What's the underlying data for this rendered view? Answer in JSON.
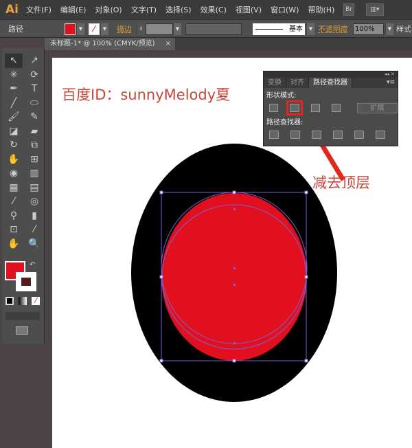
{
  "app": {
    "logo": "Ai"
  },
  "menu": [
    "文件(F)",
    "编辑(E)",
    "对象(O)",
    "文字(T)",
    "选择(S)",
    "效果(C)",
    "视图(V)",
    "窗口(W)",
    "帮助(H)"
  ],
  "menu_buttons": {
    "bridge": "Br",
    "workspace": "▥▾"
  },
  "control": {
    "type": "路径",
    "fill_color": "#e2101e",
    "stroke_label": "描边",
    "stroke_style": "基本",
    "opacity_label": "不透明度",
    "opacity": "100%",
    "style_label": "样式"
  },
  "document_tab": {
    "title": "未标题-1* @ 100% (CMYK/预览)",
    "close": "×"
  },
  "tools": [
    "↖",
    "↗",
    "✳",
    "⟳",
    "✒",
    "T",
    "╱",
    "⬭",
    "🖌",
    "✎",
    "◪",
    "▰",
    "↻",
    "⧉",
    "✋",
    "⊞",
    "◉",
    "▥",
    "▦",
    "▤",
    "⁄",
    "◎",
    "⚲",
    "▮",
    "⊡",
    "⁄",
    "✋",
    "🔍"
  ],
  "artboard": {
    "watermark": "百度ID：sunnyMelody夏",
    "annotation": "减去顶层",
    "ellipse_color": "#000000",
    "circle_color": "#e2101e",
    "selection_color": "#7a5fd0"
  },
  "panel": {
    "controls": "◂◂ ✕",
    "tabs": [
      "变换",
      "对齐",
      "路径查找器"
    ],
    "menu": "▾≡",
    "shape_modes_label": "形状模式:",
    "expand": "扩展",
    "pathfinders_label": "路径查找器:",
    "selected_button": "减去顶层"
  }
}
